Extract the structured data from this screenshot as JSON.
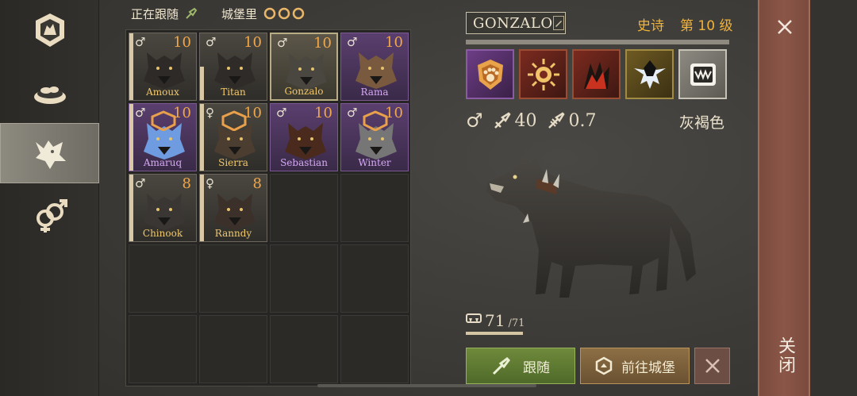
{
  "status": {
    "following_label": "正在跟随",
    "castle_label": "城堡里"
  },
  "sidebar": {
    "items": [
      {
        "name": "pack-emblem",
        "active": false
      },
      {
        "name": "food-bowl",
        "active": false
      },
      {
        "name": "wolf",
        "active": true
      },
      {
        "name": "breeding",
        "active": false
      }
    ]
  },
  "wolves": [
    {
      "name": "Amoux",
      "sex": "♂",
      "level": "10",
      "rarity": "common",
      "strip": "full",
      "fur": "#2e2a27",
      "badge": false
    },
    {
      "name": "Titan",
      "sex": "♂",
      "level": "10",
      "rarity": "common",
      "strip": "half",
      "fur": "#2f2b28",
      "badge": false
    },
    {
      "name": "Gonzalo",
      "sex": "♂",
      "level": "10",
      "rarity": "selected",
      "strip": "none",
      "fur": "#4a4741",
      "badge": false
    },
    {
      "name": "Rama",
      "sex": "♂",
      "level": "10",
      "rarity": "rare",
      "strip": "none",
      "fur": "#7a5a3e",
      "badge": false
    },
    {
      "name": "Amaruq",
      "sex": "♂",
      "level": "10",
      "rarity": "rare",
      "strip": "full",
      "fur": "#6f9be0",
      "badge": true
    },
    {
      "name": "Sierra",
      "sex": "♀",
      "level": "10",
      "rarity": "common",
      "strip": "full",
      "fur": "#4c3d31",
      "badge": true
    },
    {
      "name": "Sebastian",
      "sex": "♂",
      "level": "10",
      "rarity": "rare",
      "strip": "none",
      "fur": "#4a2a1c",
      "badge": false
    },
    {
      "name": "Winter",
      "sex": "♂",
      "level": "10",
      "rarity": "rare",
      "strip": "none",
      "fur": "#767676",
      "badge": true
    },
    {
      "name": "Chinook",
      "sex": "♂",
      "level": "8",
      "rarity": "common",
      "strip": "full",
      "fur": "#3a3633",
      "badge": false
    },
    {
      "name": "Ranndy",
      "sex": "♀",
      "level": "8",
      "rarity": "common",
      "strip": "full",
      "fur": "#3b302a",
      "badge": false
    }
  ],
  "empty_slots": 10,
  "detail": {
    "name": "GONZALO",
    "rarity": "史诗",
    "level": "第 10 级",
    "xp_fraction": 1.0,
    "sex": "♂",
    "attack": "40",
    "speed": "0.7",
    "color_name": "灰褐色",
    "food_value": "71",
    "food_max": "/71",
    "food_fraction": 1.0
  },
  "buttons": {
    "follow": "跟随",
    "go_castle": "前往城堡"
  },
  "close": {
    "label": "关闭"
  },
  "colors": {
    "accent_gold": "#f0b33c",
    "level_orange": "#f0a64a",
    "name_gold": "#f3c86a",
    "name_purple": "#d5a8f5",
    "follow_green": "#6f8a3b",
    "castle_brown": "#8d6f45",
    "close_red": "#8a5647"
  }
}
